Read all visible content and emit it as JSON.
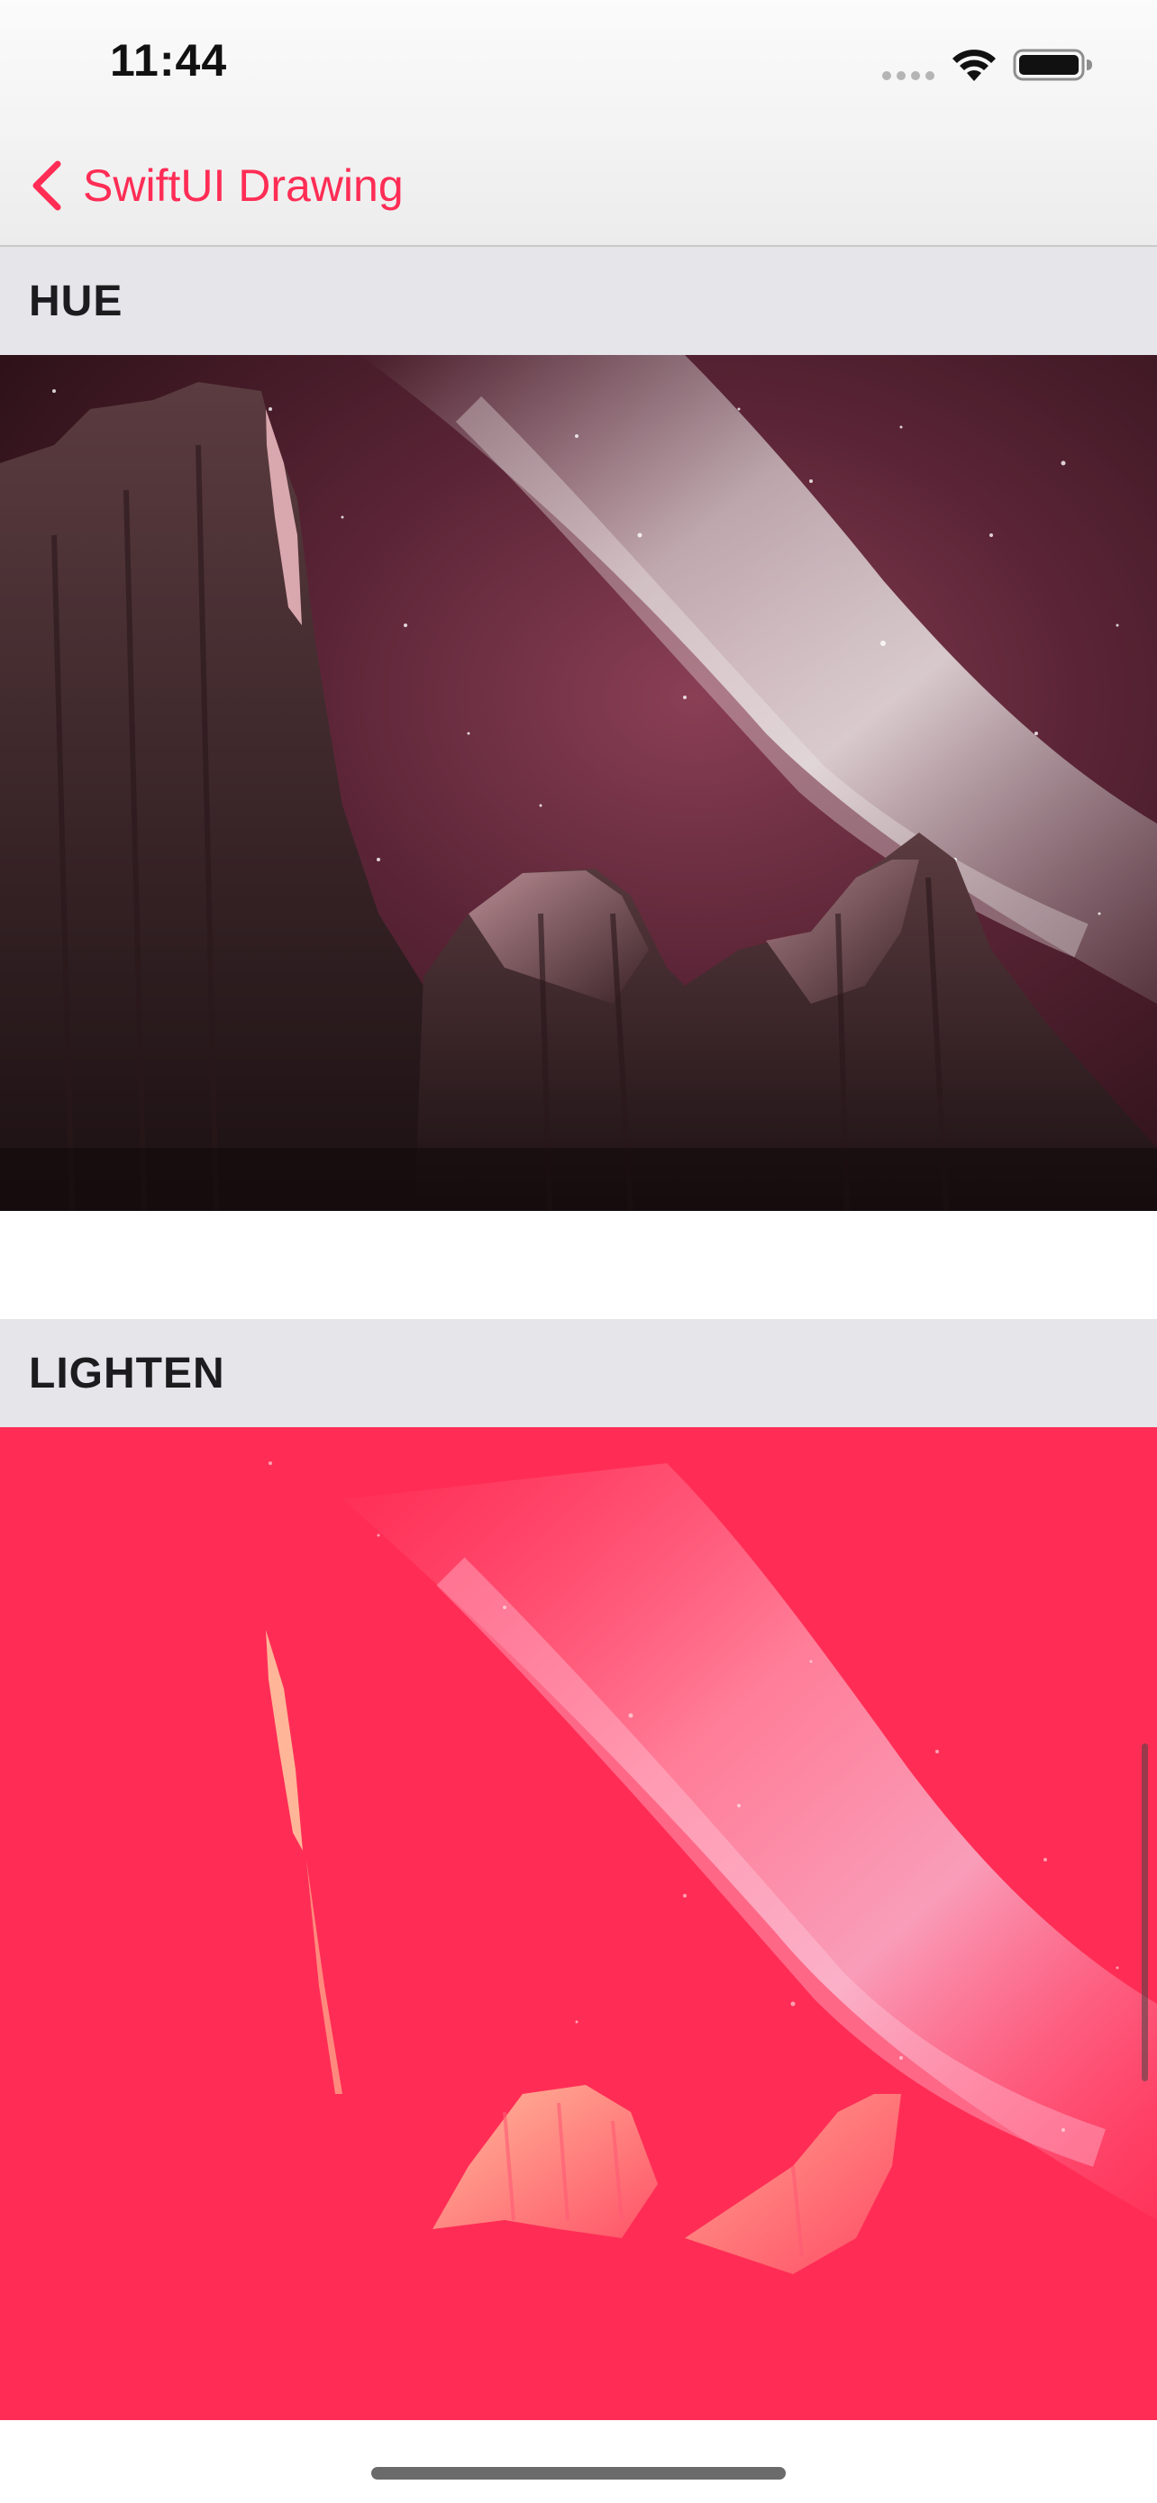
{
  "status_bar": {
    "time": "11:44"
  },
  "nav": {
    "back_label": "SwiftUI Drawing",
    "accent_color": "#ff2d55"
  },
  "sections": [
    {
      "label": "HUE",
      "image": "mountain-night-sky-hue-blend"
    },
    {
      "label": "LIGHTEN",
      "image": "mountain-night-sky-lighten-blend"
    }
  ],
  "colors": {
    "header_background": "#e5e5ea",
    "tint": "#ff2d55"
  }
}
